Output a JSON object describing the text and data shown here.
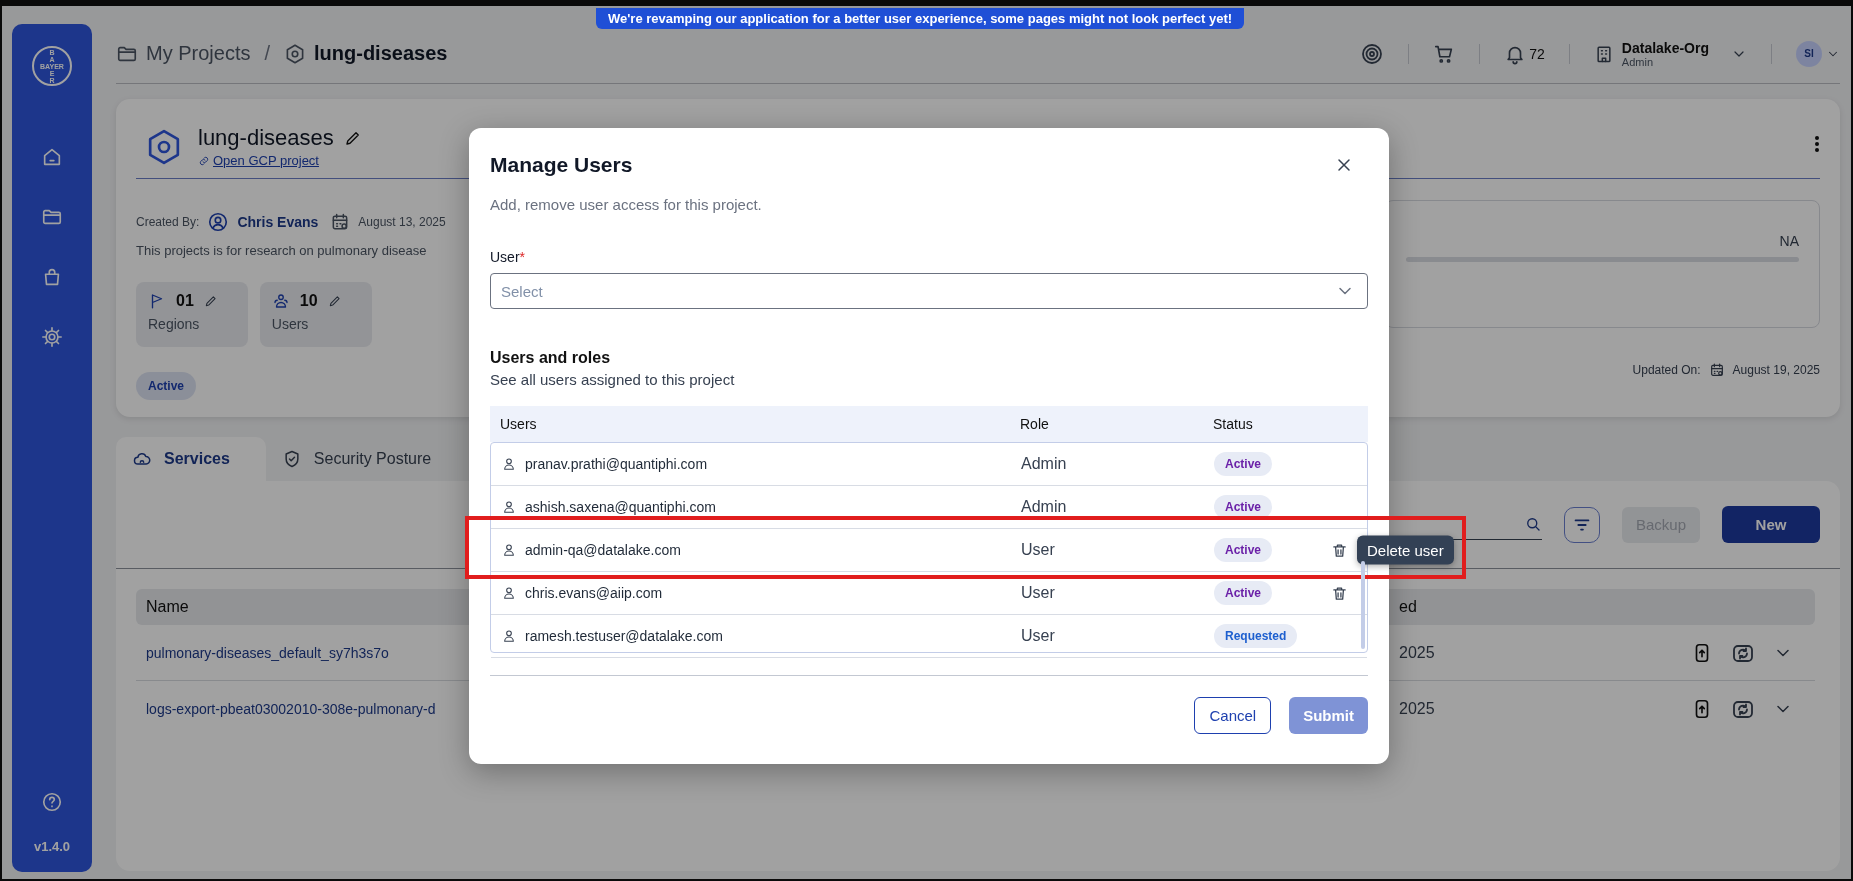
{
  "banner": {
    "text": "We're revamping our application for a better user experience, some pages might not look perfect yet!"
  },
  "sidebar": {
    "logo_horizontal": "BAYER",
    "logo_vertical_top": "BA",
    "logo_vertical_bottom": "ER",
    "version": "v1.4.0"
  },
  "header": {
    "breadcrumb": [
      {
        "label": "My Projects",
        "current": false
      },
      {
        "label": "lung-diseases",
        "current": true
      }
    ],
    "separator": "/",
    "notification_count": "72",
    "org": {
      "name": "Datalake-Org",
      "role": "Admin"
    },
    "avatar_initials": "SI"
  },
  "project": {
    "name": "lung-diseases",
    "link": "Open GCP project",
    "created_by_label": "Created By:",
    "creator": "Chris Evans",
    "created_date": "August 13, 2025",
    "description": "This projects is for research on pulmonary disease",
    "stats": [
      {
        "value": "01",
        "label": "Regions"
      },
      {
        "value": "10",
        "label": "Users"
      }
    ],
    "status": "Active",
    "summary_value": "NA",
    "updated_label": "Updated On:",
    "updated_date": "August 19, 2025"
  },
  "tabs": [
    {
      "label": "Services",
      "selected": true
    },
    {
      "label": "Security Posture",
      "selected": false
    }
  ],
  "services": {
    "backup_button": {
      "label": "Backup",
      "disabled": true
    },
    "new_button": {
      "label": "New"
    },
    "table": {
      "columns": [
        "Name",
        "ed"
      ],
      "rows": [
        {
          "name": "pulmonary-diseases_default_sy7h3s7o",
          "column_2": "2025"
        },
        {
          "name": "logs-export-pbeat03002010-308e-pulmonary-d",
          "column_2": "2025"
        }
      ]
    }
  },
  "manage_users": {
    "title": "Manage Users",
    "subtitle": "Add, remove user access for this project.",
    "field_label": "User",
    "required_mark": "*",
    "placeholder": "Select",
    "section_title": "Users and roles",
    "section_subtitle": "See all users assigned to this project",
    "columns": [
      "Users",
      "Role",
      "Status"
    ],
    "rows": [
      {
        "email": "pranav.prathi@quantiphi.com",
        "role": "Admin",
        "status": {
          "label": "Active",
          "color": "#6b21a8"
        },
        "deletable": false,
        "highlighted": false
      },
      {
        "email": "ashish.saxena@quantiphi.com",
        "role": "Admin",
        "status": {
          "label": "Active",
          "color": "#6b21a8"
        },
        "deletable": false,
        "highlighted": false
      },
      {
        "email": "admin-qa@datalake.com",
        "role": "User",
        "status": {
          "label": "Active",
          "color": "#6b21a8"
        },
        "deletable": true,
        "highlighted": true,
        "tooltip": "Delete user"
      },
      {
        "email": "chris.evans@aiip.com",
        "role": "User",
        "status": {
          "label": "Active",
          "color": "#6b21a8"
        },
        "deletable": true,
        "highlighted": false
      },
      {
        "email": "ramesh.testuser@datalake.com",
        "role": "User",
        "status": {
          "label": "Requested",
          "color": "#1d5fcf"
        },
        "deletable": false,
        "highlighted": false
      }
    ],
    "cancel_button": {
      "label": "Cancel"
    },
    "submit_button": {
      "label": "Submit",
      "disabled": true
    }
  }
}
